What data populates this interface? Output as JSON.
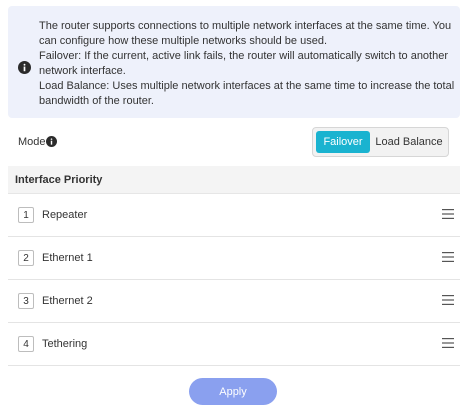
{
  "info": {
    "line1": "The router supports connections to multiple network interfaces at the same time. You can configure how these multiple networks should be used.",
    "line2": "Failover: If the current, active link fails, the router will automatically switch to another network interface.",
    "line3": "Load Balance: Uses multiple network interfaces at the same time to increase the total bandwidth of the router."
  },
  "mode": {
    "label": "Mode",
    "options": [
      "Failover",
      "Load Balance"
    ],
    "selected": "Failover"
  },
  "priority": {
    "title": "Interface Priority",
    "items": [
      {
        "num": "1",
        "label": "Repeater"
      },
      {
        "num": "2",
        "label": "Ethernet 1"
      },
      {
        "num": "3",
        "label": "Ethernet 2"
      },
      {
        "num": "4",
        "label": "Tethering"
      }
    ]
  },
  "apply_label": "Apply",
  "colors": {
    "accent": "#1ab3d0",
    "apply": "#8aa0ef",
    "info_bg": "#eef1fb"
  },
  "icons": {
    "info": "info-circle-icon",
    "drag": "drag-handle-icon"
  }
}
